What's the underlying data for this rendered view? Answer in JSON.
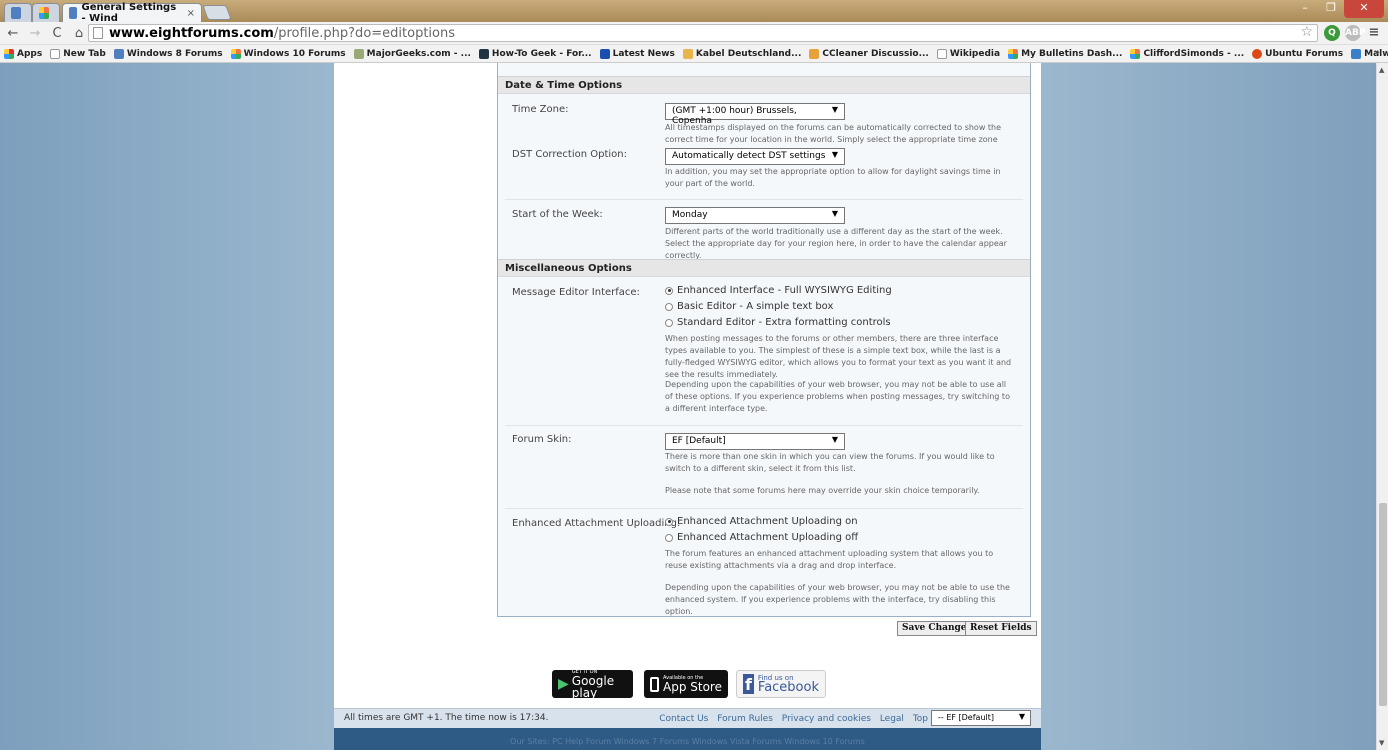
{
  "browser": {
    "tabs": [
      {
        "label": ""
      },
      {
        "label": ""
      },
      {
        "label": "General Settings - Wind",
        "close": "×"
      }
    ],
    "window_buttons": [
      "–",
      "❐",
      "✕"
    ],
    "url_host": "www.eightforums.com",
    "url_path": "/profile.php?do=editoptions",
    "bookmarks": [
      "Apps",
      "New Tab",
      "Windows 8 Forums",
      "Windows 10 Forums",
      "MajorGeeks.com - ...",
      "How-To Geek - For...",
      "Latest News",
      "Kabel Deutschland...",
      "CCleaner Discussio...",
      "Wikipedia",
      "My Bulletins Dash...",
      "CliffordSimonds - ...",
      "Ubuntu Forums",
      "Malwarebytes Unp..."
    ],
    "bookmarks_more": "»"
  },
  "date_time": {
    "heading": "Date & Time Options",
    "time_zone_label": "Time Zone:",
    "time_zone_value": "(GMT +1:00 hour) Brussels, Copenha",
    "time_zone_desc": "All timestamps displayed on the forums can be automatically corrected to show the correct time for your location in the world. Simply select the appropriate time zone from the list below.",
    "dst_label": "DST Correction Option:",
    "dst_value": "Automatically detect DST settings",
    "dst_desc": "In addition, you may set the appropriate option to allow for daylight savings time in your part of the world.",
    "week_label": "Start of the Week:",
    "week_value": "Monday",
    "week_desc": "Different parts of the world traditionally use a different day as the start of the week. Select the appropriate day for your region here, in order to have the calendar appear correctly."
  },
  "misc": {
    "heading": "Miscellaneous Options",
    "editor_label": "Message Editor Interface:",
    "editor_options": [
      "Enhanced Interface - Full WYSIWYG Editing",
      "Basic Editor - A simple text box",
      "Standard Editor - Extra formatting controls"
    ],
    "editor_selected": 0,
    "editor_desc1": "When posting messages to the forums or other members, there are three interface types available to you. The simplest of these is a simple text box, while the last is a fully-fledged WYSIWYG editor, which allows you to format your text as you want it and see the results immediately.",
    "editor_desc2": "Depending upon the capabilities of your web browser, you may not be able to use all of these options. If you experience problems when posting messages, try switching to a different interface type.",
    "skin_label": "Forum Skin:",
    "skin_value": "EF [Default]",
    "skin_desc1": "There is more than one skin in which you can view the forums. If you would like to switch to a different skin, select it from this list.",
    "skin_desc2": "Please note that some forums here may override your skin choice temporarily.",
    "attach_label": "Enhanced Attachment Uploading:",
    "attach_options": [
      "Enhanced Attachment Uploading on",
      "Enhanced Attachment Uploading off"
    ],
    "attach_selected": 0,
    "attach_desc1": "The forum features an enhanced attachment uploading system that allows you to reuse existing attachments via a drag and drop interface.",
    "attach_desc2": "Depending upon the capabilities of your web browser, you may not be able to use the enhanced system. If you experience problems with the interface, try disabling this option."
  },
  "actions": {
    "save": "Save Changes",
    "reset": "Reset Fields"
  },
  "badges": {
    "google_small": "GET IT ON",
    "google_big": "Google play",
    "apple_small": "Available on the",
    "apple_big": "App Store",
    "fb_small": "Find us on",
    "fb_big": "Facebook"
  },
  "footer": {
    "time_text": "All times are GMT +1. The time now is 17:34.",
    "links": [
      "Contact Us",
      "Forum Rules",
      "Privacy and cookies",
      "Legal",
      "Top"
    ],
    "skin_select": "-- EF [Default]",
    "bottom_links": "Our Sites:  PC Help Forum   Windows 7 Forums   Windows Vista Forums   Windows 10 Forums"
  }
}
